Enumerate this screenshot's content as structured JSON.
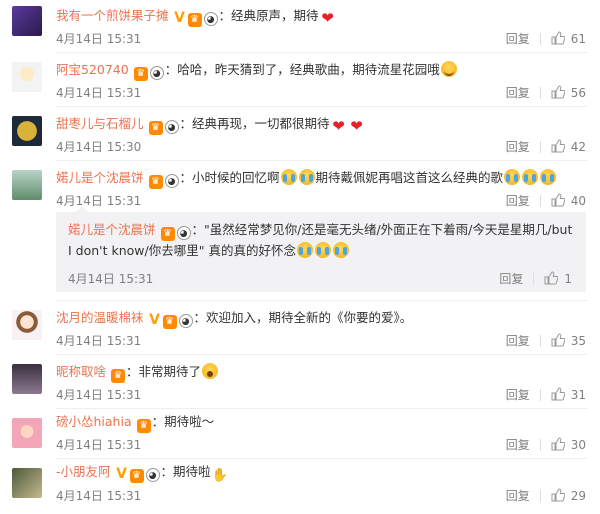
{
  "colors": {
    "username": "#eb7350",
    "meta": "#808080",
    "vip": "#ff8a00",
    "heart": "#e8202a"
  },
  "reply_label": "回复",
  "comments": [
    {
      "user": "我有一个煎饼果子摊",
      "text": "：经典原声，期待",
      "time": "4月14日 15:31",
      "likes": "61",
      "avatar": "purple-silhouette",
      "emoji": [
        "heart"
      ]
    },
    {
      "user": "阿宝520740",
      "text": "：哈哈，昨天猜到了，经典歌曲，期待流星花园哦",
      "time": "4月14日 15:31",
      "likes": "56",
      "avatar": "cartoon-girl",
      "emoji": [
        "kiss-face"
      ]
    },
    {
      "user": "甜枣儿与石榴儿",
      "text": "：经典再现，一切都很期待",
      "time": "4月14日 15:30",
      "likes": "42",
      "avatar": "moon-dark",
      "emoji": [
        "heart",
        "heart"
      ]
    },
    {
      "user": "婼儿是个沈晨饼",
      "text": "：小时候的回忆啊",
      "text2": "期待戴佩妮再唱这首这么经典的歌",
      "time": "4月14日 15:31",
      "likes": "40",
      "avatar": "person-photo",
      "emoji": [
        "cry",
        "cry"
      ],
      "emoji2": [
        "cry",
        "cry",
        "cry"
      ]
    },
    {
      "user": "沈月的温暖棉袜",
      "text": "：欢迎加入，期待全新的《你要的爱》。",
      "time": "4月14日 15:31",
      "likes": "35",
      "avatar": "anime-girl"
    },
    {
      "user": "昵称取啥",
      "text": "：非常期待了",
      "time": "4月14日 15:31",
      "likes": "31",
      "avatar": "anime-dark",
      "emoji": [
        "shock"
      ]
    },
    {
      "user": "磅小怂hiahia",
      "text": "：期待啦～",
      "time": "4月14日 15:31",
      "likes": "30",
      "avatar": "pink-photo"
    },
    {
      "user": "-小朋友阿",
      "text": "：期待啦",
      "time": "4月14日 15:31",
      "likes": "29",
      "avatar": "blurry-photo",
      "emoji": [
        "clap"
      ]
    }
  ],
  "sub_reply": {
    "user": "婼儿是个沈晨饼",
    "text": "：\"虽然经常梦见你/还是毫无头绪/外面正在下着雨/今天是星期几/but I don't know/你去哪里\" 真的真的好怀念",
    "time": "4月14日 15:31",
    "reply": "回复",
    "likes": "1",
    "emoji": [
      "cry",
      "cry",
      "cry"
    ]
  }
}
